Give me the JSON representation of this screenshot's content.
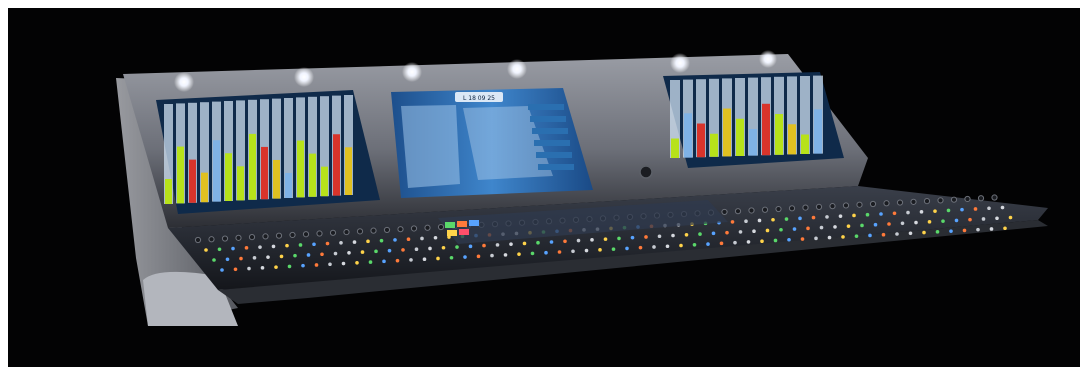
{
  "image": {
    "subject": "mixing-console",
    "background_color": "#030304"
  },
  "console": {
    "center_screen_header": "L 18 09 25"
  },
  "colors": {
    "chassis": "#8d9098",
    "chassis_dark": "#3d4048",
    "screen_blue": "#2c6fb6",
    "meter_green": "#b7e21a",
    "meter_red": "#d8342b",
    "meter_yellow": "#e0c021",
    "led_white": "#ffffff"
  }
}
